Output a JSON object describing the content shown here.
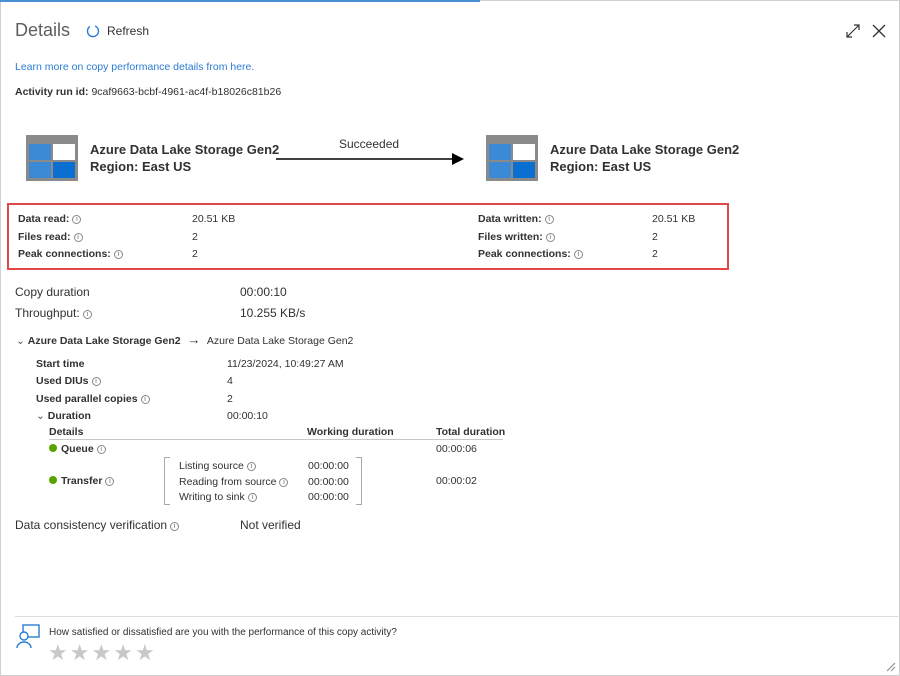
{
  "header": {
    "title": "Details",
    "refresh_label": "Refresh"
  },
  "link": "Learn more on copy performance details from here.",
  "run_id": {
    "label": "Activity run id:",
    "value": "9caf9663-bcbf-4961-ac4f-b18026c81b26"
  },
  "source": {
    "name": "Azure Data Lake Storage Gen2",
    "region": "Region: East US"
  },
  "sink": {
    "name": "Azure Data Lake Storage Gen2",
    "region": "Region: East US"
  },
  "status": "Succeeded",
  "read": [
    {
      "label": "Data read:",
      "value": "20.51 KB"
    },
    {
      "label": "Files read:",
      "value": "2"
    },
    {
      "label": "Peak connections:",
      "value": "2"
    }
  ],
  "written": [
    {
      "label": "Data written:",
      "value": "20.51 KB"
    },
    {
      "label": "Files written:",
      "value": "2"
    },
    {
      "label": "Peak connections:",
      "value": "2"
    }
  ],
  "copy_duration": {
    "label": "Copy duration",
    "value": "00:00:10"
  },
  "throughput": {
    "label": "Throughput:",
    "value": "10.255 KB/s"
  },
  "route": {
    "source": "Azure Data Lake Storage Gen2",
    "sink": "Azure Data Lake Storage Gen2"
  },
  "stats": [
    {
      "label": "Start time",
      "value": "11/23/2024, 10:49:27 AM"
    },
    {
      "label": "Used DIUs",
      "value": "4"
    },
    {
      "label": "Used parallel copies",
      "value": "2"
    }
  ],
  "duration": {
    "label": "Duration",
    "value": "00:00:10"
  },
  "table": {
    "headers": [
      "Details",
      "Working duration",
      "Total duration"
    ],
    "queue": {
      "label": "Queue",
      "total": "00:00:06"
    },
    "transfer": {
      "label": "Transfer",
      "total": "00:00:02",
      "sub": [
        {
          "label": "Listing source",
          "value": "00:00:00"
        },
        {
          "label": "Reading from source",
          "value": "00:00:00"
        },
        {
          "label": "Writing to sink",
          "value": "00:00:00"
        }
      ]
    }
  },
  "consistency": {
    "label": "Data consistency verification",
    "value": "Not verified"
  },
  "feedback": {
    "question": "How satisfied or dissatisfied are you with the performance of this copy activity?",
    "rating": 0,
    "max": 5
  }
}
